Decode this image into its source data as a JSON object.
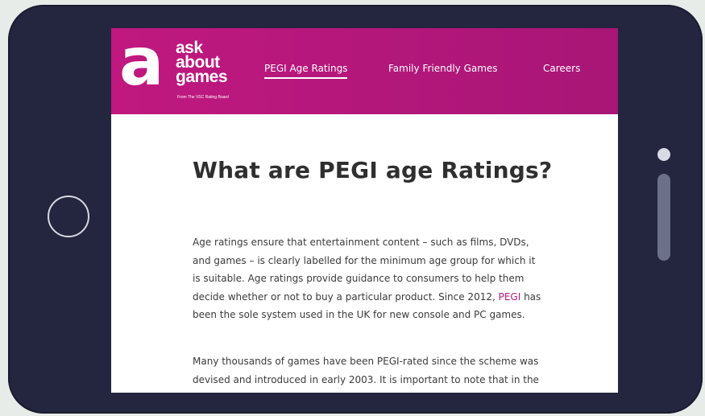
{
  "colors": {
    "device_frame": "#24253f",
    "header_brand": "#c0187f",
    "link_accent": "#c0187f",
    "page_background": "#e8ece9"
  },
  "logo": {
    "letter": "a",
    "words": [
      "ask",
      "about",
      "games"
    ],
    "tagline": "From The VSC Rating Board"
  },
  "nav": {
    "items": [
      {
        "label": "PEGI Age Ratings",
        "active": true
      },
      {
        "label": "Family Friendly Games",
        "active": false
      },
      {
        "label": "Careers",
        "active": false
      }
    ]
  },
  "article": {
    "title": "What are PEGI age Ratings?",
    "para1": {
      "line1": "Age ratings ensure that entertainment content – such as films, DVDs,",
      "line2": "and games – is clearly labelled for the minimum age group for which it",
      "line3": "is suitable. Age ratings provide guidance to consumers to help them",
      "line4_before": "decide whether or not to buy a particular product. Since 2012, ",
      "line4_link": "PEGI",
      "line4_after": " has",
      "line5": "been the sole system used in the UK for new console and PC games."
    },
    "para2": {
      "line1": "Many thousands of games have been PEGI-rated since the scheme was",
      "line2": "devised and introduced in early 2003. It is important to note that in the"
    }
  },
  "device": {
    "home_button_icon": "circle-outline-icon",
    "sensor_icon": "dot-icon",
    "speaker_icon": "slot-icon"
  }
}
